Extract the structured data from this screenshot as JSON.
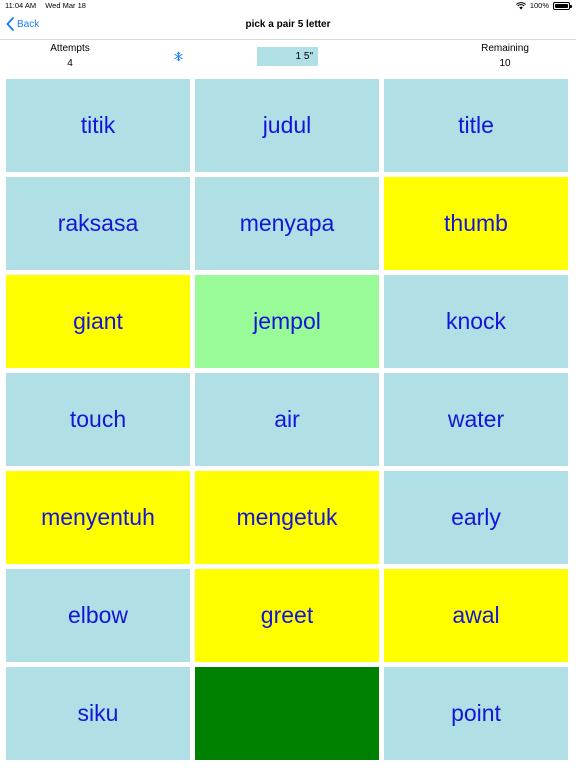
{
  "status_bar": {
    "time": "11:04 AM",
    "date": "Wed Mar 18",
    "battery": "100%"
  },
  "nav": {
    "back_label": "Back",
    "title": "pick a pair 5 letter"
  },
  "scoreboard": {
    "attempts_label": "Attempts",
    "attempts_value": "4",
    "timer": "1 5\"",
    "remaining_label": "Remaining",
    "remaining_value": "10"
  },
  "tiles": [
    {
      "word": "titik",
      "state": "normal"
    },
    {
      "word": "judul",
      "state": "normal"
    },
    {
      "word": "title",
      "state": "normal"
    },
    {
      "word": "raksasa",
      "state": "normal"
    },
    {
      "word": "menyapa",
      "state": "normal"
    },
    {
      "word": "thumb",
      "state": "selected"
    },
    {
      "word": "giant",
      "state": "selected"
    },
    {
      "word": "jempol",
      "state": "hint"
    },
    {
      "word": "knock",
      "state": "normal"
    },
    {
      "word": "touch",
      "state": "normal"
    },
    {
      "word": "air",
      "state": "normal"
    },
    {
      "word": "water",
      "state": "normal"
    },
    {
      "word": "menyentuh",
      "state": "selected"
    },
    {
      "word": "mengetuk",
      "state": "selected"
    },
    {
      "word": "early",
      "state": "normal"
    },
    {
      "word": "elbow",
      "state": "normal"
    },
    {
      "word": "greet",
      "state": "selected"
    },
    {
      "word": "awal",
      "state": "selected"
    },
    {
      "word": "siku",
      "state": "normal"
    },
    {
      "word": "",
      "state": "matched"
    },
    {
      "word": "point",
      "state": "normal"
    }
  ],
  "colors": {
    "tile_normal": "#b0dfe5",
    "tile_selected": "#ffff00",
    "tile_hint": "#98fb98",
    "tile_matched": "#008000",
    "tile_text": "#1515d6",
    "accent": "#1a7cf5"
  }
}
